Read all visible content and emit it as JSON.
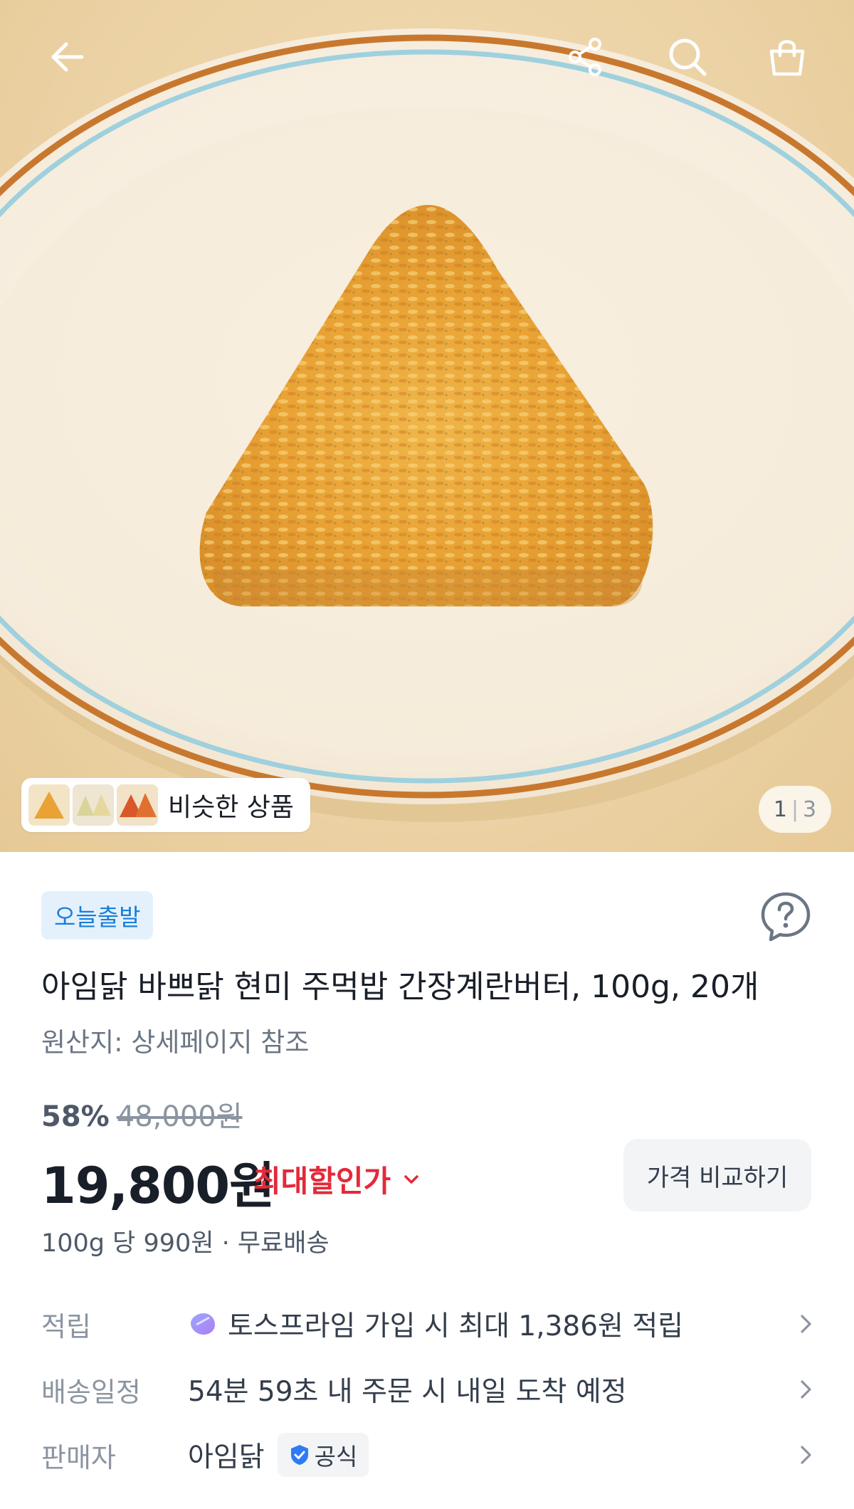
{
  "hero": {
    "similar_label": "비슷한 상품",
    "pager_current": "1",
    "pager_total": "3"
  },
  "badge": {
    "today_ship": "오늘출발"
  },
  "product": {
    "title": "아임닭 바쁘닭 현미 주먹밥 간장계란버터, 100g, 20개",
    "origin": "원산지: 상세페이지 참조"
  },
  "pricing": {
    "discount_pct": "58%",
    "original_price": "48,000원",
    "price": "19,800원",
    "max_discount_label": "최대할인가",
    "compare_label": "가격 비교하기",
    "unit_info": "100g 당 990원 · 무료배송"
  },
  "rows": {
    "points_label": "적립",
    "points_value": "토스프라임 가입 시 최대 1,386원 적립",
    "delivery_label": "배송일정",
    "delivery_value": "54분 59초 내 주문 시 내일 도착 예정",
    "seller_label": "판매자",
    "seller_value": "아임닭",
    "official_label": "공식"
  },
  "colors": {
    "accent_red": "#e42939",
    "badge_blue": "#1a7fd9",
    "badge_bg": "#e4f1fd",
    "text_dark": "#191f28",
    "text_gray": "#8b95a1"
  },
  "icons": [
    "back-arrow-icon",
    "share-icon",
    "search-icon",
    "cart-icon",
    "help-icon",
    "chevron-down-icon",
    "chevron-right-icon",
    "gem-icon",
    "verified-check-icon"
  ]
}
